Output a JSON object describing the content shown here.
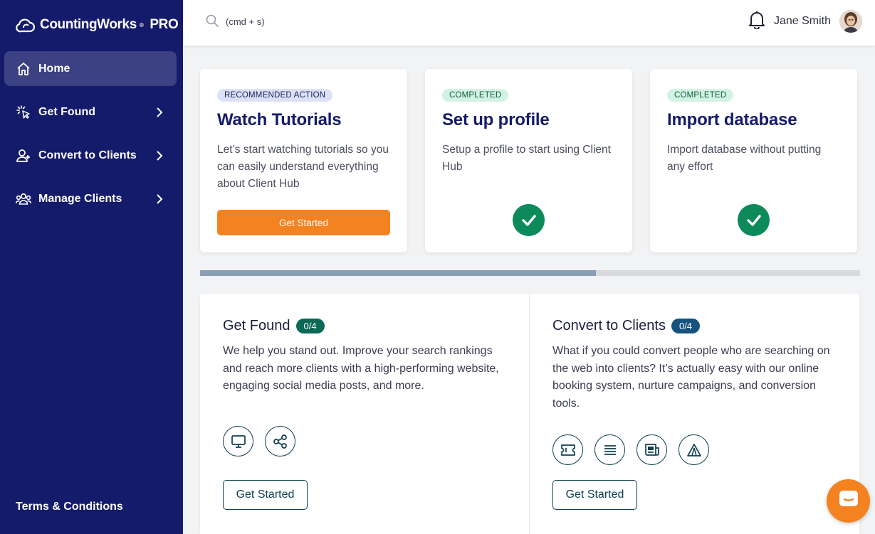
{
  "brand": {
    "name": "CountingWorks",
    "sup": "®",
    "suffix": "PRO"
  },
  "sidebar": {
    "items": [
      {
        "label": "Home",
        "icon": "home-icon",
        "active": true
      },
      {
        "label": "Get Found",
        "icon": "cursor-click-icon"
      },
      {
        "label": "Convert to Clients",
        "icon": "user-plus-icon"
      },
      {
        "label": "Manage Clients",
        "icon": "users-group-icon"
      }
    ],
    "footer_link": "Terms & Conditions"
  },
  "topbar": {
    "search_placeholder": "(cmd + s)",
    "user_name": "Jane Smith"
  },
  "cards": [
    {
      "badge": "RECOMMENDED ACTION",
      "title": "Watch Tutorials",
      "description": "Let’s start watching tutorials so you can easily understand everything about Client Hub",
      "button": "Get Started",
      "status": "recommended"
    },
    {
      "badge": "COMPLETED",
      "title": "Set up profile",
      "description": "Setup a profile to start using Client Hub",
      "status": "completed"
    },
    {
      "badge": "COMPLETED",
      "title": "Import database",
      "description": "Import database without putting any effort",
      "status": "completed"
    }
  ],
  "progress": {
    "fraction": 0.6
  },
  "sections": [
    {
      "title": "Get Found",
      "count": "0/4",
      "description": "We help you stand out. Improve your search rankings and reach more clients with a high-performing website, engaging social media posts, and more.",
      "tools": [
        "monitor-icon",
        "share-icon"
      ],
      "button": "Get Started"
    },
    {
      "title": "Convert to Clients",
      "count": "0/4",
      "description": "What if you could convert people who are searching on the web into clients? It’s actually easy with our online booking system, nurture campaigns, and conversion tools.",
      "tools": [
        "ticket-icon",
        "list-icon",
        "newsletter-icon",
        "warning-triangle-icon"
      ],
      "button": "Get Started"
    }
  ],
  "colors": {
    "sidebar_bg": "#141b6b",
    "accent_orange": "#f58220",
    "success_green": "#0d8a5a"
  }
}
